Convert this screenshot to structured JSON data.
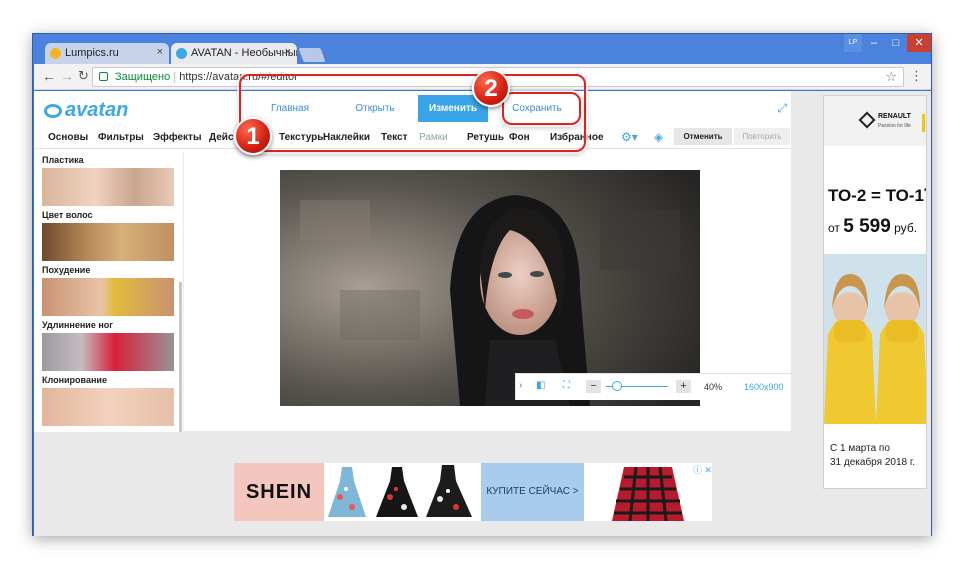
{
  "browser": {
    "tabs": [
      {
        "title": "Lumpics.ru",
        "close": "×",
        "color": "#f3b61f"
      },
      {
        "title": "AVATAN - Необычный ф",
        "close": "×",
        "color": "#3ea8e6"
      }
    ],
    "window_user": "LP",
    "window_controls": {
      "min": "–",
      "max": "□",
      "close": "✕"
    },
    "secure_label": "Защищено",
    "url": "https://avatan.ru/#/editor"
  },
  "app": {
    "logo": "avatan",
    "topnav": [
      "Главная",
      "Открыть",
      "Изменить",
      "Сохранить"
    ],
    "topnav_active": 2,
    "categories": [
      "Основы",
      "Фильтры",
      "Эффекты",
      "Действия",
      "Текстуры",
      "Наклейки",
      "Текст",
      "Рамки",
      "Ретушь",
      "Фон",
      "Избранное"
    ],
    "undo_label": "Отменить",
    "redo_label": "Повторить",
    "tools": [
      "Пластика",
      "Цвет волос",
      "Похудение",
      "Удлиннение ног",
      "Клонирование"
    ],
    "zoom": {
      "percent": "40%",
      "size": "1600x900"
    }
  },
  "ads": {
    "brand": "RENAULT",
    "brand_sub": "Passion for life",
    "promo_line1": "ТО-2 = ТО-1",
    "promo_mark": "**",
    "promo_prefix": "от",
    "promo_price": "5 599",
    "promo_currency": "руб.",
    "promo_dates": [
      "С 1 марта по",
      "31 декабря 2018 г."
    ],
    "shein": "SHEIN",
    "buy_now": "КУПИТЕ СЕЙЧАС >",
    "ad_close": "ⓘ ✕"
  },
  "annotations": {
    "badge1": "1",
    "badge2": "2"
  },
  "colors": {
    "accent": "#3ea8e6",
    "highlight": "#e0211c"
  }
}
